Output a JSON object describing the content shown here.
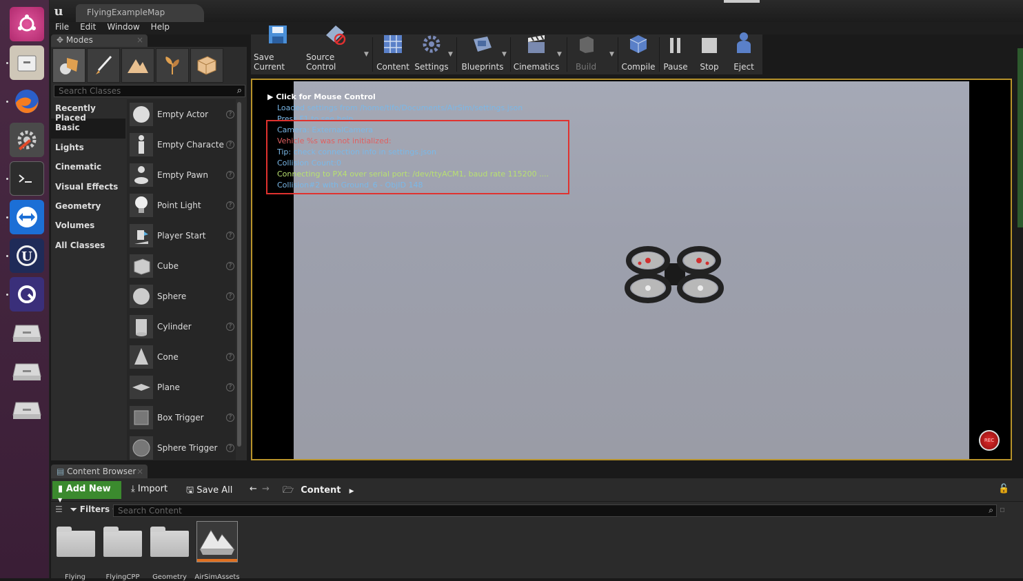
{
  "window": {
    "map_tab": "FlyingExampleMap"
  },
  "menu": [
    "File",
    "Edit",
    "Window",
    "Help"
  ],
  "modes": {
    "tab_label": "Modes",
    "search_placeholder": "Search Classes",
    "categories": [
      "Recently Placed",
      "Basic",
      "Lights",
      "Cinematic",
      "Visual Effects",
      "Geometry",
      "Volumes",
      "All Classes"
    ],
    "active_category": "Basic",
    "items": [
      "Empty Actor",
      "Empty Characte",
      "Empty Pawn",
      "Point Light",
      "Player Start",
      "Cube",
      "Sphere",
      "Cylinder",
      "Cone",
      "Plane",
      "Box Trigger",
      "Sphere Trigger"
    ]
  },
  "toolbar": {
    "save_current": "Save Current",
    "source_control": "Source Control",
    "content": "Content",
    "settings": "Settings",
    "blueprints": "Blueprints",
    "cinematics": "Cinematics",
    "build": "Build",
    "compile": "Compile",
    "pause": "Pause",
    "stop": "Stop",
    "eject": "Eject"
  },
  "viewport": {
    "mouse_control": "Click for Mouse Control",
    "messages": [
      {
        "text": "Loaded settings from /home/tifo/Documents/AirSim/settings.json",
        "color": "#7ab8e8"
      },
      {
        "text": "Press F1 to see help",
        "color": "#7ab8e8"
      },
      {
        "text": "Camera: ExternalCamera",
        "color": "#7ab8e8"
      },
      {
        "text": "Vehicle %s was not initialized:",
        "color": "#e06060"
      },
      {
        "text": "Tip: check connection info in settings.json",
        "color": "#7ab8e8"
      },
      {
        "text": "Collision Count:0",
        "color": "#7ab8e8"
      },
      {
        "text": "Connecting to PX4 over serial port: /dev/ttyACM1, baud rate 115200 ....",
        "color": "#b8e070"
      },
      {
        "text": "Collision#2 with Ground_6 - ObjID 148",
        "color": "#7ab8e8"
      }
    ],
    "rec_label": "REC"
  },
  "content_browser": {
    "tab_label": "Content Browser",
    "add_new": "Add New",
    "import": "Import",
    "save_all": "Save All",
    "path": "Content",
    "filters": "Filters",
    "search_placeholder": "Search Content",
    "tiles": [
      "Flying",
      "FlyingCPP",
      "Geometry",
      "AirSimAssets"
    ]
  },
  "colors": {
    "accent_border": "#b8932a",
    "highlight_box": "#e0322f",
    "add_new_green": "#3b8a2e"
  }
}
